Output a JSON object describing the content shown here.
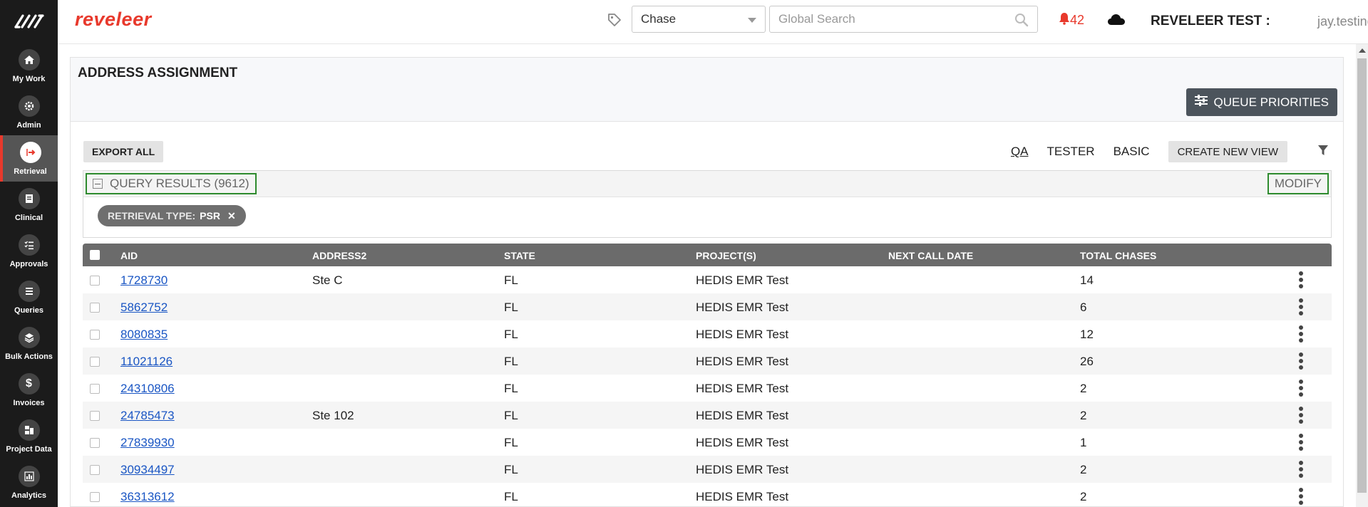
{
  "sidebar": {
    "logo_icon": "reveleer-stripes-logo-icon",
    "items": [
      {
        "label": "My Work",
        "icon": "home-icon",
        "active": false
      },
      {
        "label": "Admin",
        "icon": "gear-icon",
        "active": false
      },
      {
        "label": "Retrieval",
        "icon": "arrow-right-icon",
        "active": true
      },
      {
        "label": "Clinical",
        "icon": "clipboard-icon",
        "active": false
      },
      {
        "label": "Approvals",
        "icon": "checklist-icon",
        "active": false
      },
      {
        "label": "Queries",
        "icon": "list-icon",
        "active": false
      },
      {
        "label": "Bulk Actions",
        "icon": "layers-icon",
        "active": false
      },
      {
        "label": "Invoices",
        "icon": "dollar-icon",
        "active": false
      },
      {
        "label": "Project Data",
        "icon": "project-data-icon",
        "active": false
      },
      {
        "label": "Analytics",
        "icon": "bar-chart-icon",
        "active": false
      }
    ]
  },
  "header": {
    "brand": "reveleer",
    "entity_select": "Chase",
    "search_placeholder": "Global Search",
    "notifications_count": "42",
    "org_label": "REVELEER TEST :",
    "username": "jay.testing"
  },
  "page": {
    "title": "ADDRESS ASSIGNMENT",
    "queue_priorities_label": "QUEUE PRIORITIES",
    "export_all_label": "EXPORT ALL",
    "views": [
      "QA",
      "TESTER",
      "BASIC"
    ],
    "active_view": "QA",
    "create_view_label": "CREATE NEW VIEW"
  },
  "query": {
    "results_label": "QUERY RESULTS (9612)",
    "modify_label": "MODIFY",
    "filter_chip": {
      "key": "RETRIEVAL TYPE:",
      "value": "PSR"
    }
  },
  "grid": {
    "columns": [
      "AID",
      "ADDRESS2",
      "STATE",
      "PROJECT(S)",
      "NEXT CALL DATE",
      "TOTAL CHASES"
    ],
    "rows": [
      {
        "aid": "1728730",
        "address2": "Ste C",
        "state": "FL",
        "projects": "HEDIS EMR Test",
        "next_call_date": "",
        "total_chases": "14"
      },
      {
        "aid": "5862752",
        "address2": "",
        "state": "FL",
        "projects": "HEDIS EMR Test",
        "next_call_date": "",
        "total_chases": "6"
      },
      {
        "aid": "8080835",
        "address2": "",
        "state": "FL",
        "projects": "HEDIS EMR Test",
        "next_call_date": "",
        "total_chases": "12"
      },
      {
        "aid": "11021126",
        "address2": "",
        "state": "FL",
        "projects": "HEDIS EMR Test",
        "next_call_date": "",
        "total_chases": "26"
      },
      {
        "aid": "24310806",
        "address2": "",
        "state": "FL",
        "projects": "HEDIS EMR Test",
        "next_call_date": "",
        "total_chases": "2"
      },
      {
        "aid": "24785473",
        "address2": "Ste 102",
        "state": "FL",
        "projects": "HEDIS EMR Test",
        "next_call_date": "",
        "total_chases": "2"
      },
      {
        "aid": "27839930",
        "address2": "",
        "state": "FL",
        "projects": "HEDIS EMR Test",
        "next_call_date": "",
        "total_chases": "1"
      },
      {
        "aid": "30934497",
        "address2": "",
        "state": "FL",
        "projects": "HEDIS EMR Test",
        "next_call_date": "",
        "total_chases": "2"
      },
      {
        "aid": "36313612",
        "address2": "",
        "state": "FL",
        "projects": "HEDIS EMR Test",
        "next_call_date": "",
        "total_chases": "2"
      }
    ]
  },
  "colors": {
    "brand_red": "#e8392c",
    "sidebar_bg": "#1b1b1b",
    "header_gray": "#6b6b6b",
    "link_blue": "#1a56c4",
    "highlight_green": "#2e8b2e"
  }
}
